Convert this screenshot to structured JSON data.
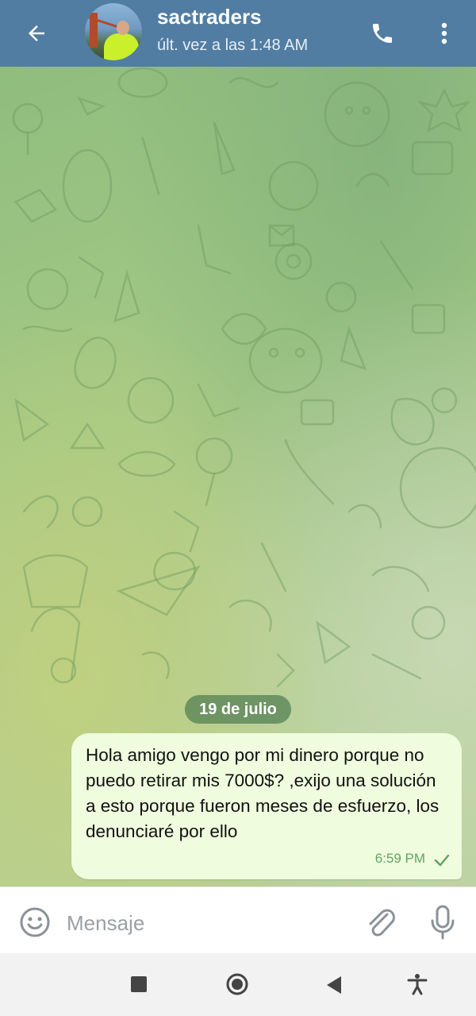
{
  "header": {
    "contact_name": "sactraders",
    "last_seen": "últ. vez a las 1:48 AM",
    "back_icon": "arrow-left-icon",
    "call_icon": "phone-icon",
    "menu_icon": "more-vert-icon",
    "bg_color": "#517DA2"
  },
  "chat": {
    "date_separator": "19 de julio",
    "messages": [
      {
        "text": "Hola amigo vengo por mi dinero porque no puedo retirar mis 7000$? ,exijo una solución a esto porque fueron meses de esfuerzo, los denunciaré por ello",
        "time": "6:59 PM",
        "status_icon": "check-icon",
        "outgoing": true
      }
    ],
    "bubble_color": "#EFFDDE"
  },
  "input_bar": {
    "placeholder": "Mensaje",
    "emoji_icon": "emoji-icon",
    "attach_icon": "paperclip-icon",
    "mic_icon": "microphone-icon"
  },
  "system_nav": {
    "recents_icon": "square-icon",
    "home_icon": "circle-home-icon",
    "back_icon": "triangle-back-icon",
    "accessibility_icon": "accessibility-icon"
  }
}
